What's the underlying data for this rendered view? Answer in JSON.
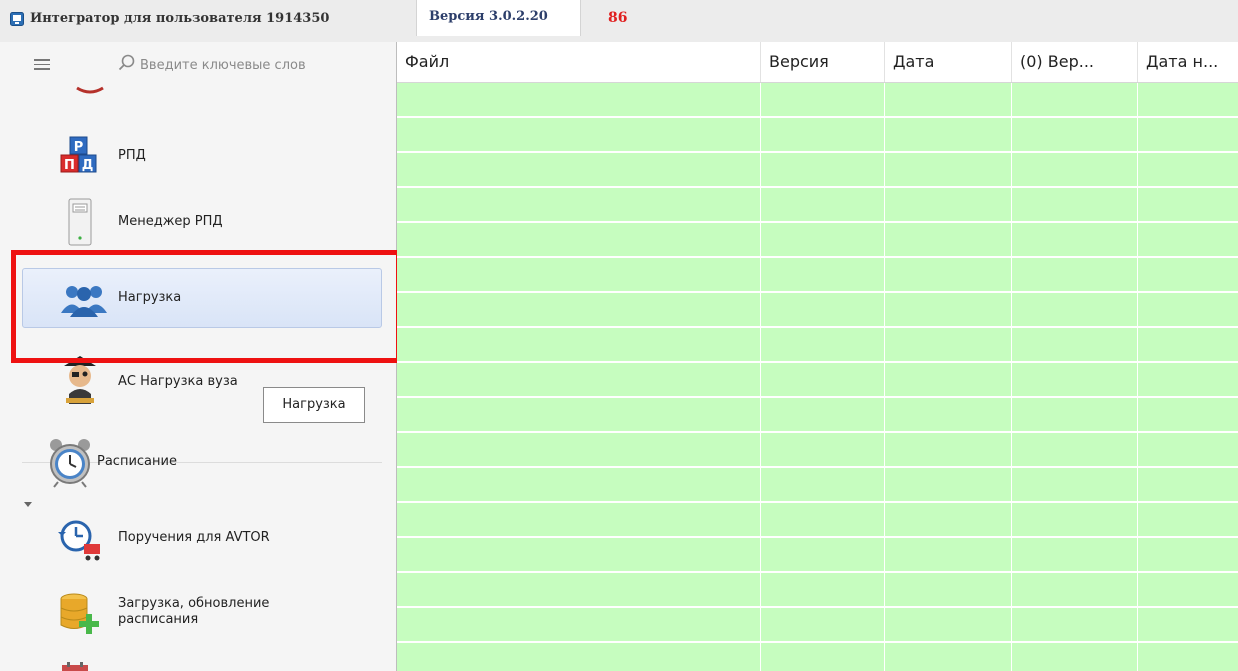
{
  "window": {
    "title": "Интегратор для пользователя 1914350",
    "version_tab": "Версия 3.0.2.20",
    "counter": "86"
  },
  "sidebar": {
    "search_placeholder": "Введите ключевые слов",
    "items": [
      {
        "label": "РПД",
        "icon": "rpd-blocks-icon"
      },
      {
        "label": "Менеджер РПД",
        "icon": "server-icon"
      },
      {
        "label": "Нагрузка",
        "icon": "users-group-icon",
        "selected": true
      },
      {
        "label": "АС Нагрузка вуза",
        "icon": "pirate-mascot-icon"
      },
      {
        "label": "Расписание",
        "icon": "alarm-clock-icon",
        "group": true,
        "expanded": true
      },
      {
        "label": "Поручения для AVTOR",
        "icon": "clock-cart-icon"
      },
      {
        "label": "Загрузка, обновление расписания",
        "icon": "database-add-icon"
      }
    ],
    "tooltip": "Нагрузка"
  },
  "grid": {
    "columns": [
      "Файл",
      "Версия",
      "Дата",
      "(0) Вер...",
      "Дата н..."
    ],
    "row_color": "#c6fdbf"
  },
  "colors": {
    "highlight": "#ee1111",
    "counter": "#e02020",
    "selected_bg": "#dde7f8"
  }
}
